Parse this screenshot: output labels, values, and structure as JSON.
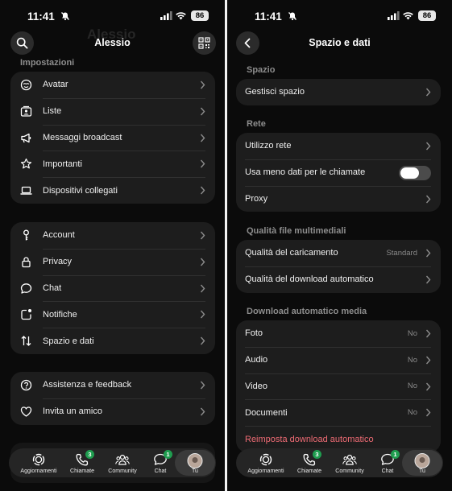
{
  "status_bar": {
    "time": "11:41",
    "battery": "86"
  },
  "left": {
    "profile_name": "Alessio",
    "header_title": "Alessio",
    "section_title": "Impostazioni",
    "group1": [
      {
        "label": "Avatar",
        "icon": "avatar-icon"
      },
      {
        "label": "Liste",
        "icon": "lists-icon"
      },
      {
        "label": "Messaggi broadcast",
        "icon": "megaphone-icon"
      },
      {
        "label": "Importanti",
        "icon": "star-icon"
      },
      {
        "label": "Dispositivi collegati",
        "icon": "laptop-icon"
      }
    ],
    "group2": [
      {
        "label": "Account",
        "icon": "key-icon"
      },
      {
        "label": "Privacy",
        "icon": "lock-icon"
      },
      {
        "label": "Chat",
        "icon": "chat-bubble-icon"
      },
      {
        "label": "Notifiche",
        "icon": "notification-icon"
      },
      {
        "label": "Spazio e dati",
        "icon": "data-transfer-icon"
      }
    ],
    "group3": [
      {
        "label": "Assistenza e feedback",
        "icon": "help-icon"
      },
      {
        "label": "Invita un amico",
        "icon": "heart-icon"
      }
    ]
  },
  "right": {
    "header_title": "Spazio e dati",
    "section_space": "Spazio",
    "space_items": [
      {
        "label": "Gestisci spazio"
      }
    ],
    "section_network": "Rete",
    "network_items": [
      {
        "label": "Utilizzo rete"
      },
      {
        "label": "Usa meno dati per le chiamate",
        "toggle": false
      },
      {
        "label": "Proxy"
      }
    ],
    "section_media_quality": "Qualità file multimediali",
    "media_quality_items": [
      {
        "label": "Qualità del caricamento",
        "value": "Standard"
      },
      {
        "label": "Qualità del download automatico"
      }
    ],
    "section_auto_download": "Download automatico media",
    "auto_download_items": [
      {
        "label": "Foto",
        "value": "No"
      },
      {
        "label": "Audio",
        "value": "No"
      },
      {
        "label": "Video",
        "value": "No"
      },
      {
        "label": "Documenti",
        "value": "No"
      }
    ],
    "reset_label": "Reimposta download automatico"
  },
  "tabbar": {
    "tabs": [
      {
        "label": "Aggiornamenti",
        "icon": "updates-icon"
      },
      {
        "label": "Chiamate",
        "icon": "phone-icon",
        "badge": "3"
      },
      {
        "label": "Community",
        "icon": "community-icon"
      },
      {
        "label": "Chat",
        "icon": "chats-icon",
        "badge": "1"
      },
      {
        "label": "Tu",
        "icon": "profile-avatar"
      }
    ]
  },
  "colors": {
    "background": "#0b0b0b",
    "card": "#1d1d1d",
    "danger": "#ee6b74",
    "badge": "#1f9d4f"
  }
}
